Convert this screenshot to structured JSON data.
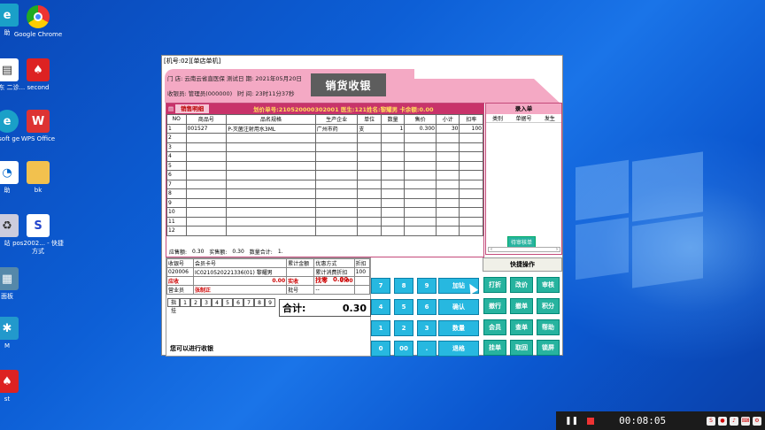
{
  "desktop": {
    "icons": [
      {
        "label": "助",
        "icon": "edge-icon"
      },
      {
        "label": "Google Chrome",
        "icon": "chrome-icon"
      },
      {
        "label": "_广东 二诊...",
        "icon": "file-icon"
      },
      {
        "label": "second",
        "icon": "red-app-icon"
      },
      {
        "label": "osoft ge",
        "icon": "edge-icon"
      },
      {
        "label": "WPS Office",
        "icon": "wps-icon"
      },
      {
        "label": "助",
        "icon": "app-icon"
      },
      {
        "label": "bk",
        "icon": "folder-icon"
      },
      {
        "label": "站",
        "icon": "recycle-icon"
      },
      {
        "label": "pos2002... - 快捷方式",
        "icon": "pos-icon"
      },
      {
        "label": "面板",
        "icon": "panel-icon"
      },
      {
        "label": "M",
        "icon": "app-icon"
      },
      {
        "label": "st",
        "icon": "red-app-icon"
      }
    ]
  },
  "window": {
    "title": "[机号:02][单店单机]"
  },
  "header": {
    "store": "门 店: 云南云省直医保 测试店(0003)",
    "date": "日 期: 2021年05月20日",
    "cashier": "收银员: 管理员(000000) 【管理】",
    "time": "时 间: 23时11分37秒",
    "title": "销货收银"
  },
  "sales": {
    "panel_title": "销售明细",
    "info": "划价单号:210520000302001 医生:121姓名:黎耀男 卡余额:0.00",
    "columns": [
      "NO",
      "商品号",
      "品名规格",
      "生产企业",
      "单位",
      "数量",
      "售价",
      "小计",
      "扣率"
    ],
    "rows": [
      [
        "1",
        "001527",
        "P-灭菌注射用水3ML",
        "广州市药",
        "支",
        "1",
        "0.300",
        "30",
        "100"
      ],
      [
        "2",
        "",
        "",
        "",
        "",
        "",
        "",
        "",
        ""
      ],
      [
        "3",
        "",
        "",
        "",
        "",
        "",
        "",
        "",
        ""
      ],
      [
        "4",
        "",
        "",
        "",
        "",
        "",
        "",
        "",
        ""
      ],
      [
        "5",
        "",
        "",
        "",
        "",
        "",
        "",
        "",
        ""
      ],
      [
        "6",
        "",
        "",
        "",
        "",
        "",
        "",
        "",
        ""
      ],
      [
        "7",
        "",
        "",
        "",
        "",
        "",
        "",
        "",
        ""
      ],
      [
        "8",
        "",
        "",
        "",
        "",
        "",
        "",
        "",
        ""
      ],
      [
        "9",
        "",
        "",
        "",
        "",
        "",
        "",
        "",
        ""
      ],
      [
        "10",
        "",
        "",
        "",
        "",
        "",
        "",
        "",
        ""
      ],
      [
        "11",
        "",
        "",
        "",
        "",
        "",
        "",
        "",
        ""
      ],
      [
        "12",
        "",
        "",
        "",
        "",
        "",
        "",
        "",
        ""
      ]
    ],
    "summary": {
      "due_label": "应售额:",
      "due": "0.30",
      "actual_label": "实售额:",
      "actual": "0.30",
      "qty_label": "数量合计:",
      "qty": "1."
    }
  },
  "entry": {
    "title": "录入单",
    "columns": [
      "类别",
      "单据号",
      "发生"
    ],
    "pending_button": "待审核单"
  },
  "payment": {
    "header": [
      "收银号",
      "会员卡号",
      "累计金额",
      "优惠方式",
      "折扣"
    ],
    "row1": [
      "020006",
      "IC0210520221336(01) 黎耀男",
      "",
      "累计消费折扣",
      "100"
    ],
    "receivable_label": "应收",
    "receivable": "0.00",
    "received_label": "实收",
    "received": "0.00",
    "change_label": "找零",
    "change": "0.00",
    "clerk_label": "营业员",
    "clerk": "张制正",
    "batch_label": "批号",
    "batch": "--",
    "digit_label": "指 挂",
    "digits": [
      "1",
      "2",
      "3",
      "4",
      "5",
      "6",
      "7",
      "8",
      "9"
    ],
    "total_label": "合计:",
    "total": "0.30",
    "message": "您可以进行收银"
  },
  "keypad": {
    "keys": [
      "7",
      "8",
      "9",
      "加钻",
      "4",
      "5",
      "6",
      "确认",
      "1",
      "2",
      "3",
      "数量",
      "0",
      "00",
      ".",
      "退格"
    ]
  },
  "quick": {
    "title": "快捷操作",
    "buttons": [
      "打折",
      "改价",
      "审核",
      "撤行",
      "撤单",
      "积分",
      "会员",
      "查单",
      "帮助",
      "挂单",
      "取回",
      "锁屏"
    ]
  },
  "recorder": {
    "time": "00:08:05"
  }
}
